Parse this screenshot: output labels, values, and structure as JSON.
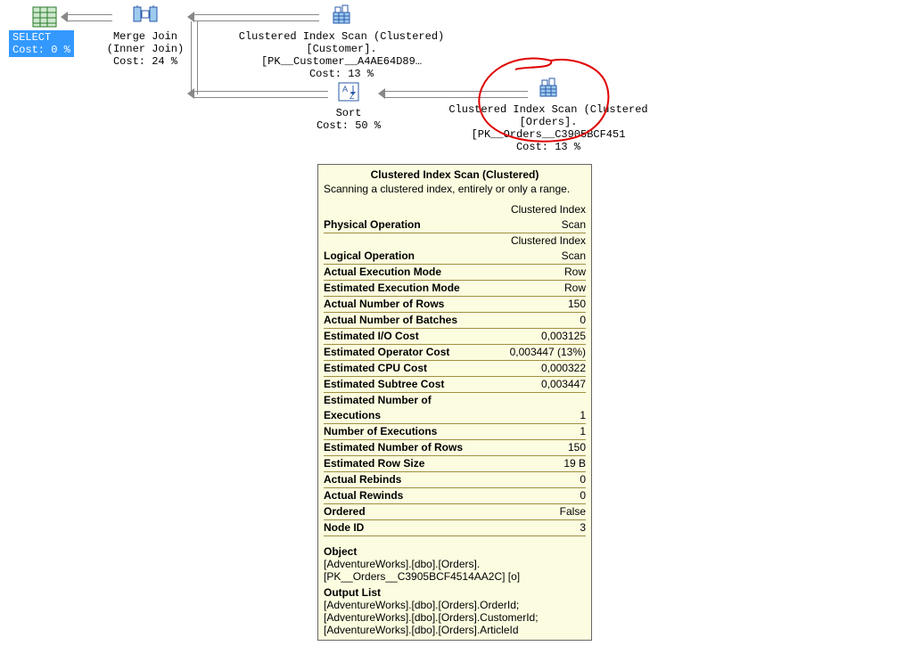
{
  "select": {
    "label": "SELECT",
    "cost": "Cost: 0 %"
  },
  "mergeJoin": {
    "line1": "Merge Join",
    "line2": "(Inner Join)",
    "cost": "Cost: 24 %"
  },
  "scanCustomer": {
    "line1": "Clustered Index Scan (Clustered)",
    "line2": "[Customer].[PK__Customer__A4AE64D89…",
    "cost": "Cost: 13 %"
  },
  "sort": {
    "line1": "Sort",
    "cost": "Cost: 50 %"
  },
  "scanOrders": {
    "line1": "Clustered Index Scan (Clustered",
    "line2": "[Orders].[PK__Orders__C3905BCF451",
    "cost": "Cost: 13 %"
  },
  "tooltip": {
    "title": "Clustered Index Scan (Clustered)",
    "desc": "Scanning a clustered index, entirely or only a range.",
    "rows": [
      {
        "k": "Physical Operation",
        "v": "Clustered Index Scan"
      },
      {
        "k": "Logical Operation",
        "v": "Clustered Index Scan"
      },
      {
        "k": "Actual Execution Mode",
        "v": "Row"
      },
      {
        "k": "Estimated Execution Mode",
        "v": "Row"
      },
      {
        "k": "Actual Number of Rows",
        "v": "150"
      },
      {
        "k": "Actual Number of Batches",
        "v": "0"
      },
      {
        "k": "Estimated I/O Cost",
        "v": "0,003125"
      },
      {
        "k": "Estimated Operator Cost",
        "v": "0,003447 (13%)"
      },
      {
        "k": "Estimated CPU Cost",
        "v": "0,000322"
      },
      {
        "k": "Estimated Subtree Cost",
        "v": "0,003447"
      },
      {
        "k": "Estimated Number of Executions",
        "v": "1"
      },
      {
        "k": "Number of Executions",
        "v": "1"
      },
      {
        "k": "Estimated Number of Rows",
        "v": "150"
      },
      {
        "k": "Estimated Row Size",
        "v": "19 B"
      },
      {
        "k": "Actual Rebinds",
        "v": "0"
      },
      {
        "k": "Actual Rewinds",
        "v": "0"
      },
      {
        "k": "Ordered",
        "v": "False"
      },
      {
        "k": "Node ID",
        "v": "3"
      }
    ],
    "objectLabel": "Object",
    "objectLines": [
      "[AdventureWorks].[dbo].[Orders].",
      "[PK__Orders__C3905BCF4514AA2C] [o]"
    ],
    "outputLabel": "Output List",
    "outputLines": [
      "[AdventureWorks].[dbo].[Orders].OrderId;",
      "[AdventureWorks].[dbo].[Orders].CustomerId;",
      "[AdventureWorks].[dbo].[Orders].ArticleId"
    ]
  }
}
